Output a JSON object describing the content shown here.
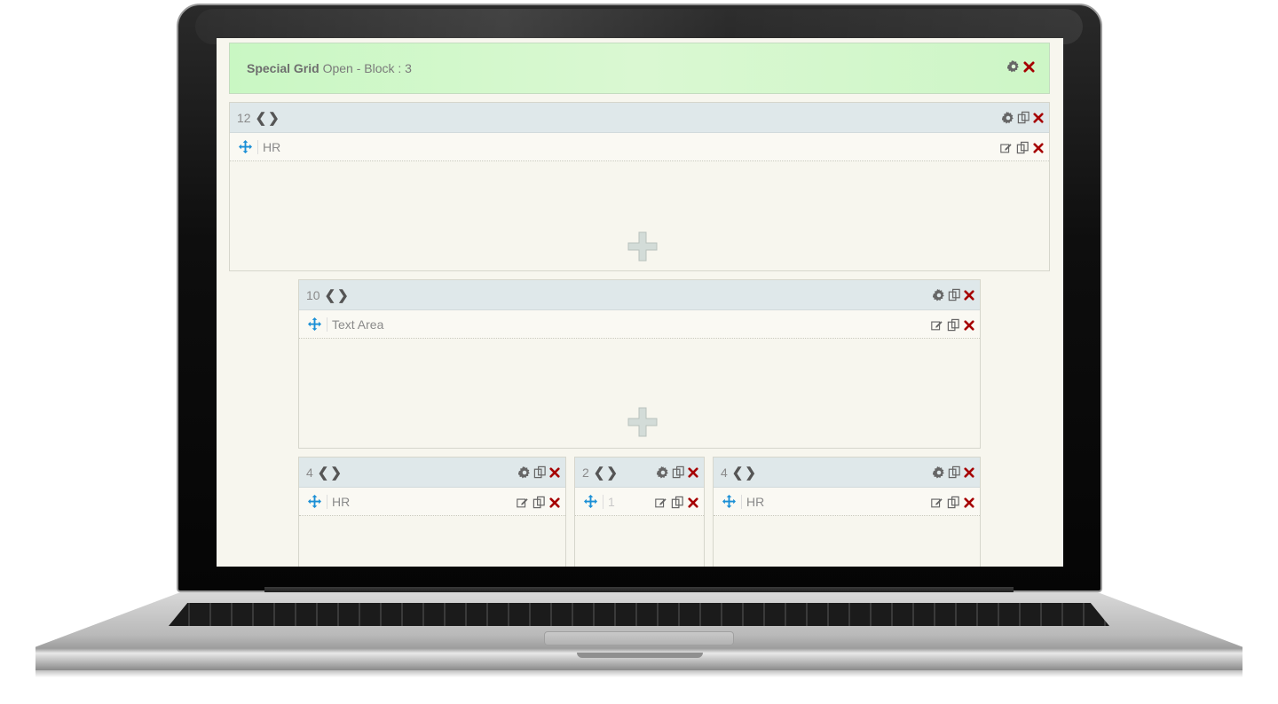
{
  "block": {
    "title_bold": "Special Grid",
    "title_rest": "Open - Block : 3"
  },
  "rows": {
    "row12": {
      "size": "12",
      "element": "HR"
    },
    "row10": {
      "size": "10",
      "element": "Text Area"
    },
    "col_a": {
      "size": "4",
      "element": "HR"
    },
    "col_b": {
      "size": "2",
      "element": "1"
    },
    "col_c": {
      "size": "4",
      "element": "HR"
    }
  },
  "colors": {
    "header_green": "#c9f7c3",
    "row_head": "#dfe8ea",
    "canvas": "#f7f6ee",
    "move_icon": "#1a8fd6",
    "delete_icon": "#a60000"
  },
  "icons": [
    "gear-icon",
    "copy-icon",
    "close-icon",
    "edit-icon",
    "move-icon",
    "chevron-left-icon",
    "chevron-right-icon",
    "plus-icon"
  ]
}
